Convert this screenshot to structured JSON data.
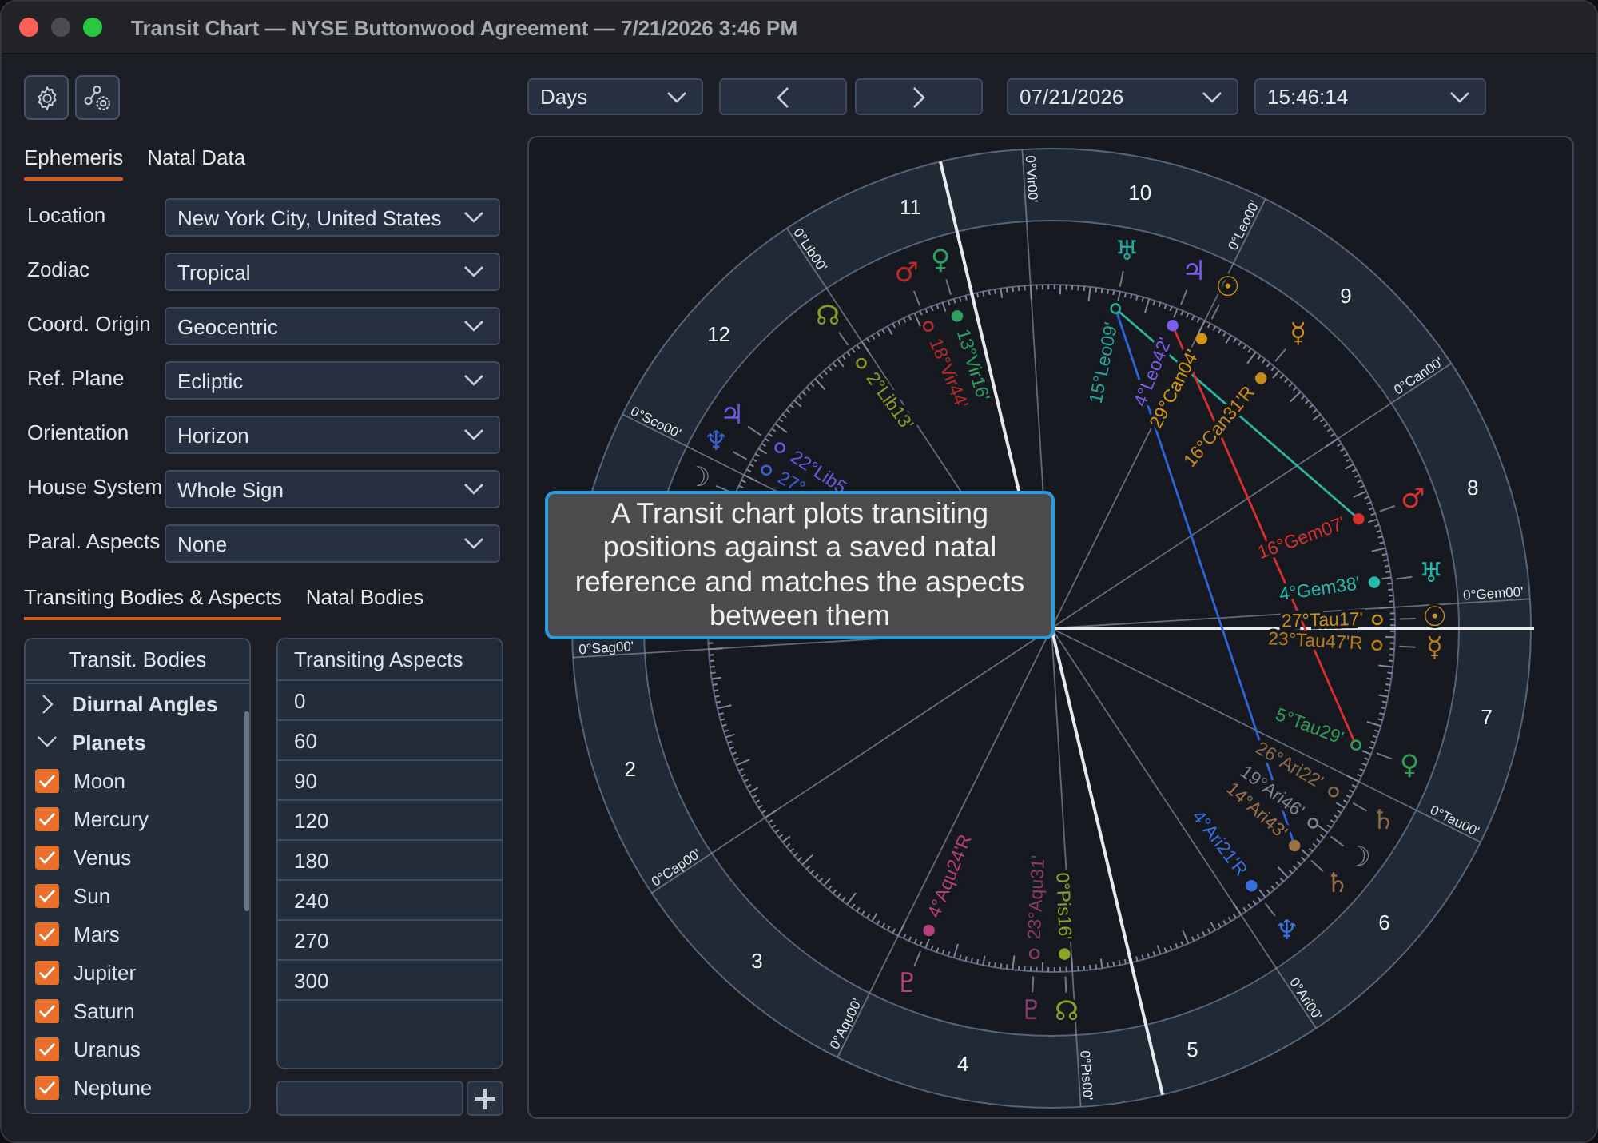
{
  "window": {
    "title": "Transit Chart — NYSE Buttonwood Agreement — 7/21/2026 3:46 PM"
  },
  "settings_tabs": [
    {
      "label": "Ephemeris",
      "selected": true
    },
    {
      "label": "Natal Data",
      "selected": false
    }
  ],
  "settings": [
    {
      "label": "Location",
      "value": "New York City, United States"
    },
    {
      "label": "Zodiac",
      "value": "Tropical"
    },
    {
      "label": "Coord. Origin",
      "value": "Geocentric"
    },
    {
      "label": "Ref. Plane",
      "value": "Ecliptic"
    },
    {
      "label": "Orientation",
      "value": "Horizon"
    },
    {
      "label": "House System",
      "value": "Whole Sign"
    },
    {
      "label": "Paral. Aspects",
      "value": "None"
    }
  ],
  "bodies_tabs": [
    {
      "label": "Transiting Bodies & Aspects",
      "selected": true
    },
    {
      "label": "Natal Bodies",
      "selected": false
    }
  ],
  "transit_bodies": {
    "header": "Transit. Bodies",
    "groups": [
      {
        "label": "Diurnal Angles",
        "expanded": false
      },
      {
        "label": "Planets",
        "expanded": true,
        "children": [
          {
            "label": "Moon",
            "checked": true
          },
          {
            "label": "Mercury",
            "checked": true
          },
          {
            "label": "Venus",
            "checked": true
          },
          {
            "label": "Sun",
            "checked": true
          },
          {
            "label": "Mars",
            "checked": true
          },
          {
            "label": "Jupiter",
            "checked": true
          },
          {
            "label": "Saturn",
            "checked": true
          },
          {
            "label": "Uranus",
            "checked": true
          },
          {
            "label": "Neptune",
            "checked": true
          }
        ]
      }
    ]
  },
  "transiting_aspects": {
    "header": "Transiting Aspects",
    "rows": [
      "0",
      "60",
      "90",
      "120",
      "180",
      "240",
      "270",
      "300"
    ]
  },
  "toolbar": {
    "period": "Days",
    "date": "07/21/2026",
    "time": "15:46:14"
  },
  "chart": {
    "house_numbers": [
      "2",
      "3",
      "4",
      "5",
      "6",
      "7",
      "8",
      "9",
      "10",
      "11",
      "12"
    ],
    "sign_cusps": [
      "0°Gem00'",
      "0°Can00'",
      "0°Leo00'",
      "0°Vir00'",
      "0°Lib00'",
      "0°Sco00'",
      "0°Sag00'",
      "0°Cap00'",
      "0°Aqu00'",
      "0°Pis00'",
      "0°Ari00'",
      "0°Tau00'"
    ],
    "bodies": [
      {
        "glyph": "♅",
        "label": "15°Leo09'",
        "kind": "natal",
        "color": "#26a69a"
      },
      {
        "glyph": "♃",
        "label": "4°Leo42'",
        "kind": "transit",
        "color": "#7b5cf0"
      },
      {
        "glyph": "☉",
        "label": "29°Can04'",
        "kind": "transit",
        "color": "#d4960f"
      },
      {
        "glyph": "☿",
        "label": "16°Can31'R",
        "kind": "transit",
        "color": "#c98a1c"
      },
      {
        "glyph": "♂",
        "label": "16°Gem07'",
        "kind": "transit",
        "color": "#d8302f"
      },
      {
        "glyph": "♅",
        "label": "4°Gem38'",
        "kind": "transit",
        "color": "#25b8a8"
      },
      {
        "glyph": "☉",
        "label": "27°Tau17'",
        "kind": "natal",
        "color": "#c9901c"
      },
      {
        "glyph": "☿",
        "label": "23°Tau47'R",
        "kind": "natal",
        "color": "#b87c18"
      },
      {
        "glyph": "♀",
        "label": "5°Tau29'",
        "kind": "natal",
        "color": "#2e9e55"
      },
      {
        "glyph": "♄",
        "label": "26°Ari22'",
        "kind": "natal",
        "color": "#8a6a4a"
      },
      {
        "glyph": "☽",
        "label": "19°Ari46'",
        "kind": "natal",
        "color": "#80838b"
      },
      {
        "glyph": "♄",
        "label": "14°Ari43'",
        "kind": "transit",
        "color": "#9a7048"
      },
      {
        "glyph": "♆",
        "label": "4°Ari21'R",
        "kind": "transit",
        "color": "#3b6fe0"
      },
      {
        "glyph": "☊",
        "label": "0°Pis16'",
        "kind": "transit",
        "color": "#8aa526"
      },
      {
        "glyph": "♇",
        "label": "23°Aqu31'",
        "kind": "natal",
        "color": "#8a3a6a"
      },
      {
        "glyph": "♇",
        "label": "4°Aqu24'R",
        "kind": "transit",
        "color": "#b8407a"
      },
      {
        "glyph": "☊",
        "label": "2°Lib13'",
        "kind": "natal",
        "color": "#8a9a26"
      },
      {
        "glyph": "♂",
        "label": "18°Vir44'",
        "kind": "natal",
        "color": "#b82a2a"
      },
      {
        "glyph": "♀",
        "label": "13°Vir16'",
        "kind": "transit",
        "color": "#2ea060"
      },
      {
        "glyph": "♃",
        "label": "22°Lib5",
        "kind": "natal",
        "color": "#6a5ae0"
      },
      {
        "glyph": "♆",
        "label": "27°",
        "kind": "natal",
        "color": "#3b5fd0"
      },
      {
        "glyph": "☽",
        "kind": "natal",
        "color": "#80838b"
      }
    ],
    "aspects": [
      {
        "color": "#2ab5a2"
      },
      {
        "color": "#2f63d8"
      },
      {
        "color": "#d83030"
      }
    ]
  },
  "tooltip": "A Transit chart plots transiting positions against a saved natal reference and matches the aspects between them"
}
